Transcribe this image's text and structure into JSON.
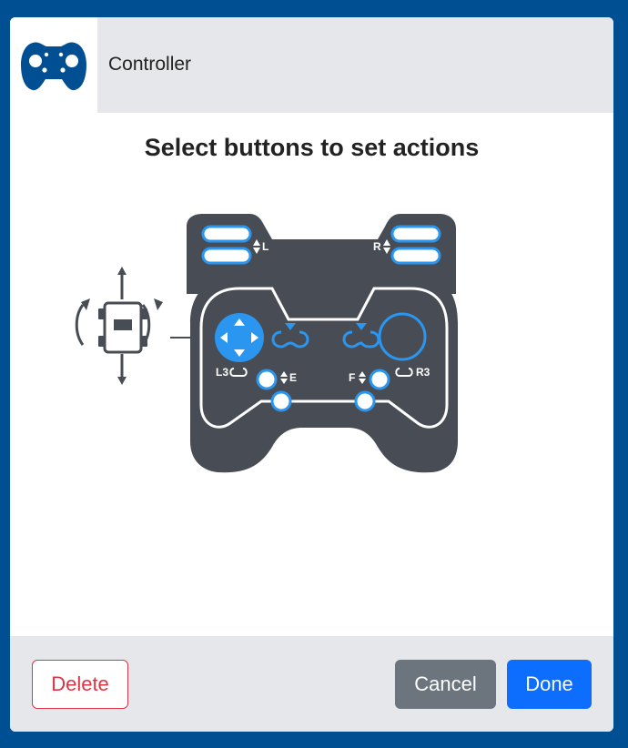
{
  "header": {
    "title": "Controller",
    "icon": "gamepad-icon"
  },
  "prompt": "Select buttons to set actions",
  "controller": {
    "labels": {
      "left_bumper": "L",
      "right_bumper": "R",
      "l3": "L3",
      "r3": "R3",
      "e": "E",
      "f": "F"
    },
    "selected_input": "left-joystick",
    "colors": {
      "body": "#484c54",
      "accent": "#2b96f0"
    }
  },
  "footer": {
    "delete_label": "Delete",
    "cancel_label": "Cancel",
    "done_label": "Done"
  },
  "colors": {
    "frame": "#004f93",
    "delete": "#dc3545",
    "cancel": "#6c757d",
    "done": "#0d6efd"
  }
}
